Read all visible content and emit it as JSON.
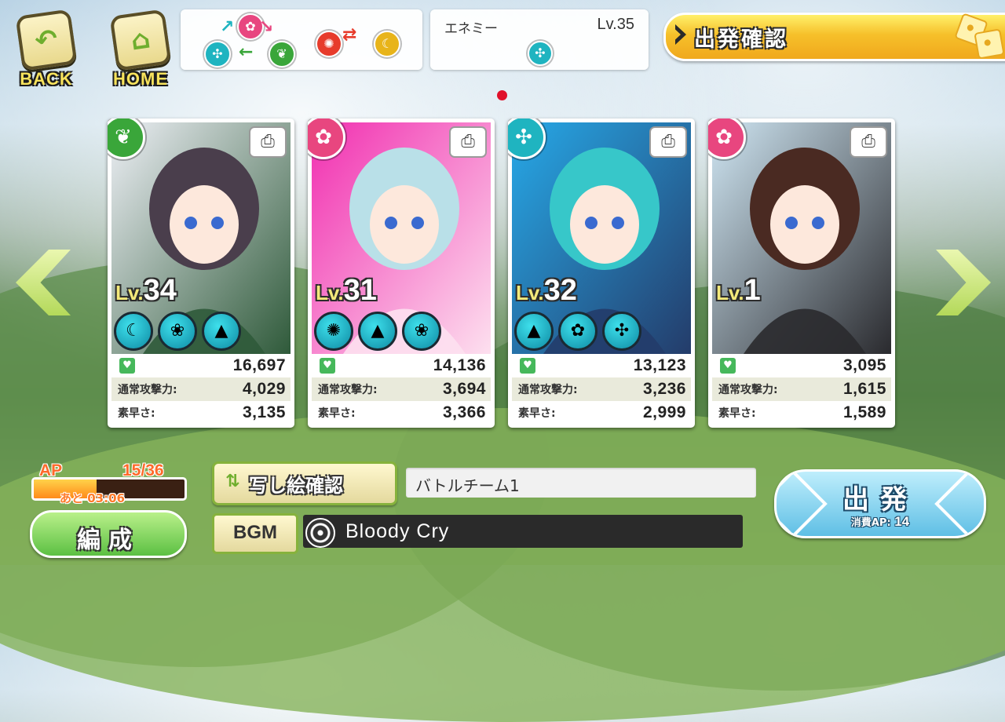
{
  "nav": {
    "back_label": "BACK",
    "home_label": "HOME"
  },
  "enemy": {
    "label": "エネミー",
    "level": "Lv.35",
    "element_icon": "pinwheel-icon"
  },
  "depart_confirm_label": "出発確認",
  "colors": {
    "flower": "#e8467f",
    "leaf": "#3aa63a",
    "wind": "#1fb4c0",
    "sun": "#e73b2b",
    "moon": "#e8b41a"
  },
  "cards": [
    {
      "element": "leaf",
      "element_icon": "leaf-icon",
      "level_prefix": "Lv.",
      "level": "34",
      "hp": "16,697",
      "attack_label": "通常攻撃力:",
      "attack": "4,029",
      "speed_label": "素早さ:",
      "speed": "3,135",
      "skills": [
        "moon-icon",
        "apple-recover-icon",
        "stone-up-icon"
      ],
      "art": [
        "#eef0f6",
        "#4a3e4c",
        "#2f5a3a"
      ]
    },
    {
      "element": "flower",
      "element_icon": "plum-blossom-icon",
      "level_prefix": "Lv.",
      "level": "31",
      "hp": "14,136",
      "attack_label": "通常攻撃力:",
      "attack": "3,694",
      "speed_label": "素早さ:",
      "speed": "3,366",
      "skills": [
        "sun-icon",
        "spirit-up-icon",
        "apple-recover-icon"
      ],
      "art": [
        "#f12fb0",
        "#b9e0e8",
        "#fde0ef"
      ]
    },
    {
      "element": "wind",
      "element_icon": "pinwheel-icon",
      "level_prefix": "Lv.",
      "level": "32",
      "hp": "13,123",
      "attack_label": "通常攻撃力:",
      "attack": "3,236",
      "speed_label": "素早さ:",
      "speed": "2,999",
      "skills": [
        "talisman-up-icon",
        "flower-up-icon",
        "pinwheel-icon"
      ],
      "art": [
        "#27a9e8",
        "#37c7c9",
        "#243c6a"
      ]
    },
    {
      "element": "flower",
      "element_icon": "plum-blossom-icon",
      "level_prefix": "Lv.",
      "level": "1",
      "hp": "3,095",
      "attack_label": "通常攻撃力:",
      "attack": "1,615",
      "speed_label": "素早さ:",
      "speed": "1,589",
      "skills": [],
      "art": [
        "#cfe6f3",
        "#4a2a22",
        "#2a2a2e"
      ]
    }
  ],
  "ap": {
    "label": "AP",
    "value": "15/36",
    "current": 15,
    "max": 36,
    "timer": "あと 03:06"
  },
  "formation_label": "編成",
  "portrait_check_label": "写し絵確認",
  "team_name": "バトルチーム1",
  "bgm": {
    "button_label": "BGM",
    "track": "Bloody Cry"
  },
  "depart": {
    "label": "出発",
    "cost_label": "消費AP:",
    "cost_value": "14"
  }
}
